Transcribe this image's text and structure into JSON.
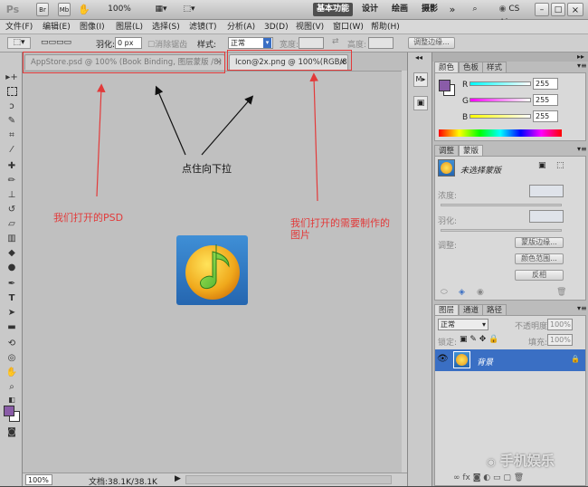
{
  "app": {
    "logo": "Ps",
    "bridge_btn": "Br",
    "minibridge_btn": "Mb",
    "zoom": "100%",
    "workspaces": [
      "基本功能",
      "设计",
      "绘画",
      "摄影"
    ],
    "more": "»",
    "cslive": "CS Live",
    "window_controls": [
      "–",
      "□",
      "×"
    ]
  },
  "menubar": [
    "文件(F)",
    "编辑(E)",
    "图像(I)",
    "图层(L)",
    "选择(S)",
    "滤镜(T)",
    "分析(A)",
    "3D(D)",
    "视图(V)",
    "窗口(W)",
    "帮助(H)"
  ],
  "options": {
    "feather_label": "羽化:",
    "feather_value": "0 px",
    "antialias_label": "消除锯齿",
    "style_label": "样式:",
    "style_value": "正常",
    "width_label": "宽度:",
    "height_label": "高度:",
    "refine_edge": "调整边缘..."
  },
  "tabs": [
    {
      "label": "AppStore.psd @ 100% (Book Binding, 图层蒙版 /8) *",
      "close": "×"
    },
    {
      "label": "Icon@2x.png @ 100%(RGB/8)",
      "close": "×"
    }
  ],
  "annotations": {
    "drag_down": "点住向下拉",
    "psd_note": "我们打开的PSD",
    "target_note_line1": "我们打开的需要制作的",
    "target_note_line2": "图片"
  },
  "status": {
    "zoom": "100%",
    "doc": "文档:38.1K/38.1K"
  },
  "color_panel": {
    "tabs": [
      "颜色",
      "色板",
      "样式"
    ],
    "channels": [
      {
        "label": "R",
        "value": "255"
      },
      {
        "label": "G",
        "value": "255"
      },
      {
        "label": "B",
        "value": "255"
      }
    ],
    "fg_color": "#8a5ca8"
  },
  "adjust_panel": {
    "tabs": [
      "调整",
      "蒙版"
    ],
    "title": "未选择蒙版",
    "density_label": "浓度:",
    "feather_label": "羽化:",
    "refine_label": "调整:",
    "mask_edge_btn": "蒙版边缘...",
    "color_range_btn": "颜色范围...",
    "invert_btn": "反相"
  },
  "layers_panel": {
    "tabs": [
      "图层",
      "通道",
      "路径"
    ],
    "blend_mode": "正常",
    "opacity_label": "不透明度:",
    "opacity_value": "100%",
    "lock_label": "锁定:",
    "fill_label": "填充:",
    "fill_value": "100%",
    "layer_name": "背景"
  },
  "watermark": "手机娱乐",
  "colors": {
    "accent_red": "#e23a3a",
    "selected_layer": "#3a6fc4"
  }
}
